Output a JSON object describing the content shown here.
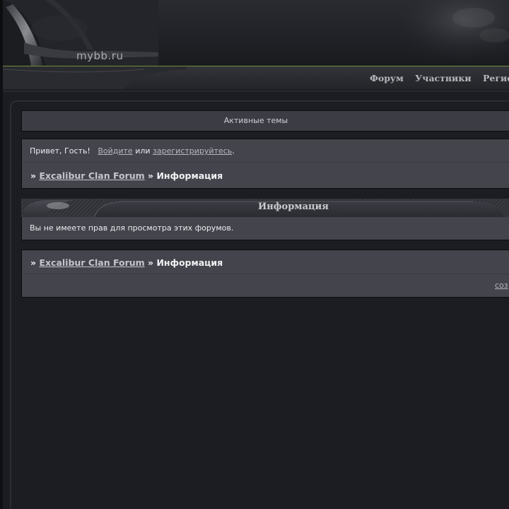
{
  "header": {
    "logo": "mybb.ru"
  },
  "nav": {
    "items": [
      "Форум",
      "Участники",
      "Регистра"
    ]
  },
  "active_topics": "Активные темы",
  "welcome": {
    "greeting": "Привет, Гость!",
    "login_link": "Войдите",
    "or": "или",
    "register_link": "зарегистрируйтесь",
    "period": "."
  },
  "breadcrumb": {
    "separator": "»",
    "forum_link": "Excalibur Clan Forum",
    "current": "Информация"
  },
  "info": {
    "title": "Информация",
    "message": "Вы не имеете прав для просмотра этих форумов."
  },
  "footer": {
    "create_link": "соз"
  },
  "colors": {
    "background": "#1c1d22",
    "box": "#43444c",
    "accent_line": "#6f8c3c"
  }
}
